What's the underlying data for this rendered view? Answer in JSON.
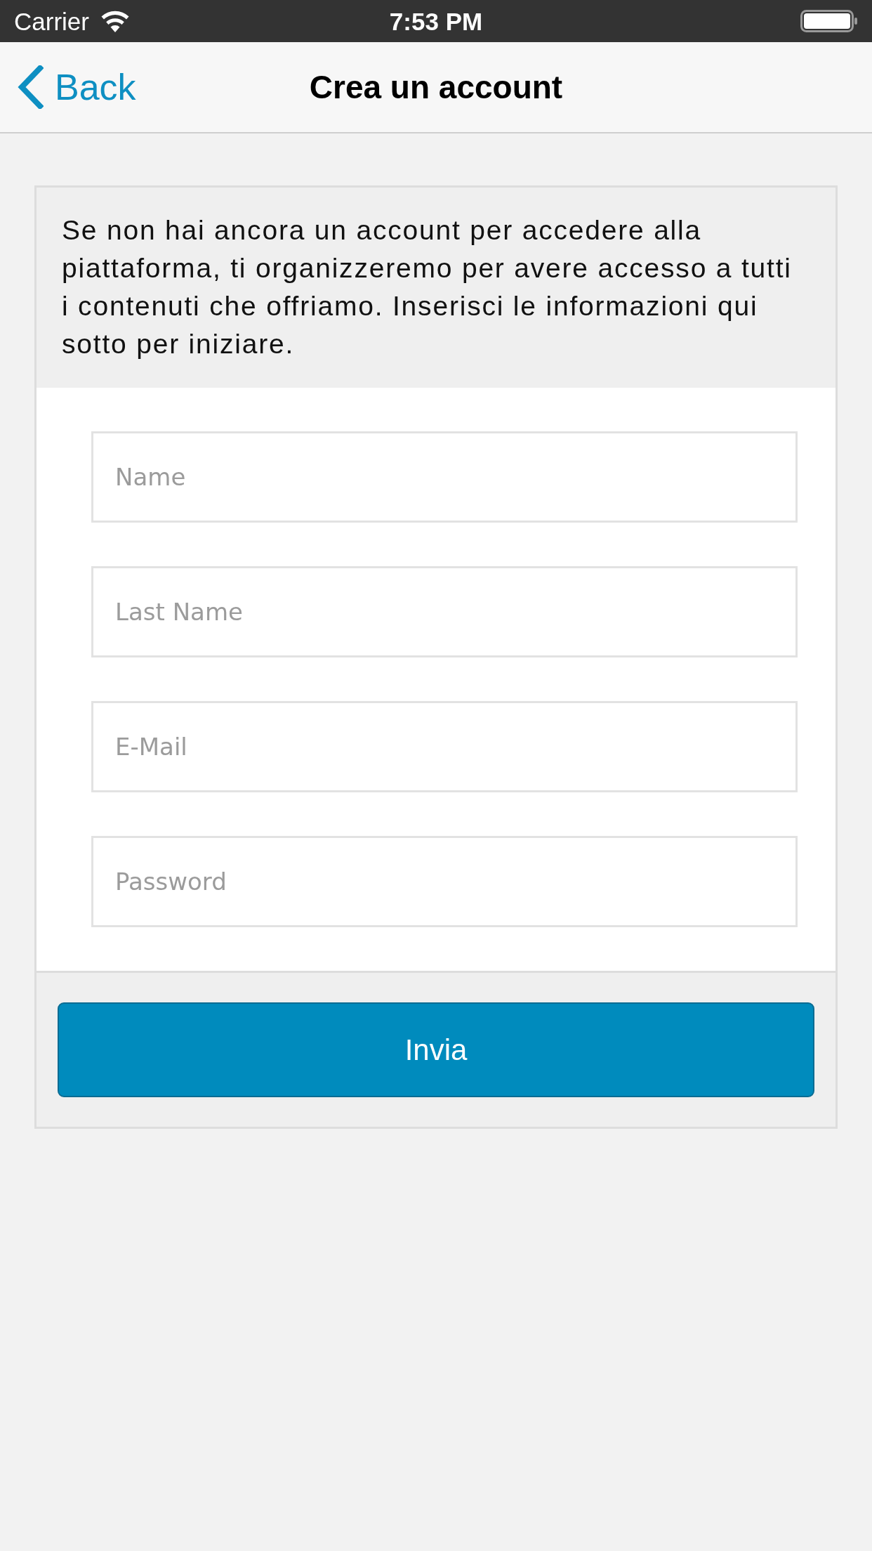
{
  "status_bar": {
    "carrier": "Carrier",
    "time": "7:53 PM"
  },
  "nav_bar": {
    "back_label": "Back",
    "title": "Crea un account"
  },
  "intro": "Se non hai ancora un account per accedere alla piattaforma, ti organizzeremo per avere accesso a tutti i contenuti che offriamo. Inserisci le informazioni qui sotto per iniziare.",
  "form": {
    "fields": [
      {
        "placeholder": "Name"
      },
      {
        "placeholder": "Last Name"
      },
      {
        "placeholder": "E-Mail"
      },
      {
        "placeholder": "Password"
      }
    ]
  },
  "submit_button": "Invia"
}
